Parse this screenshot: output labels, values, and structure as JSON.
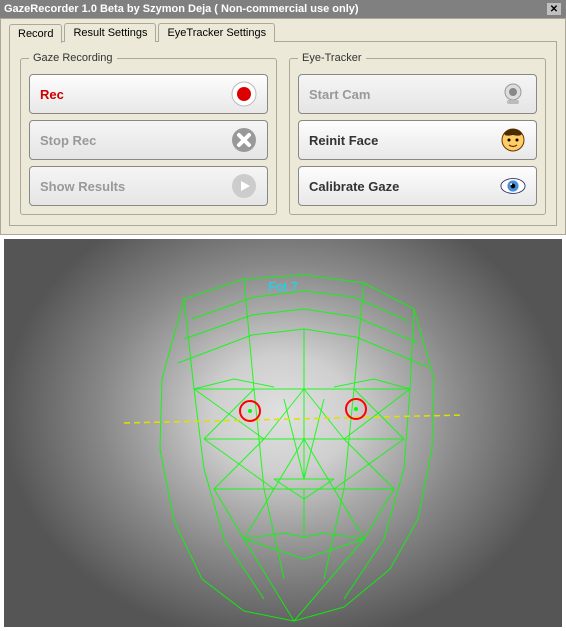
{
  "window": {
    "title": "GazeRecorder 1.0 Beta  by Szymon Deja  ( Non-commercial use only)"
  },
  "tabs": [
    {
      "label": "Record",
      "active": true
    },
    {
      "label": "Result Settings",
      "active": false
    },
    {
      "label": "EyeTracker Settings",
      "active": false
    }
  ],
  "gazeRecording": {
    "legend": "Gaze Recording",
    "rec": "Rec",
    "stop": "Stop Rec",
    "show": "Show Results"
  },
  "eyeTracker": {
    "legend": "Eye-Tracker",
    "start": "Start Cam",
    "reinit": "Reinit Face",
    "calibrate": "Calibrate Gaze"
  },
  "preview": {
    "overlay": "Fot 7"
  },
  "icons": {
    "close": "✕"
  }
}
